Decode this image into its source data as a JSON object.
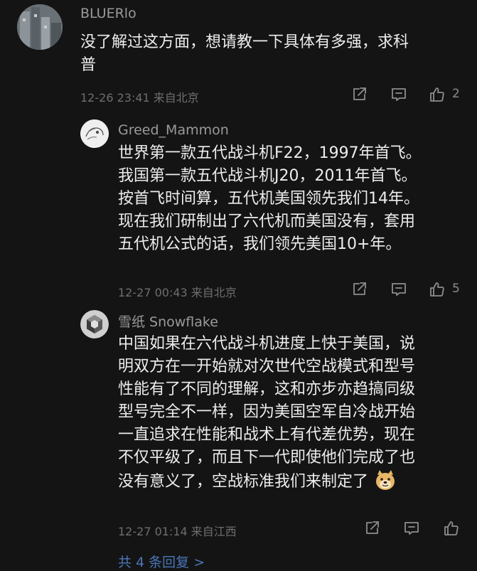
{
  "comments": [
    {
      "username": "BLUERlo",
      "lines": [
        "没了解过这方面，想请教一下具体有多强，求科",
        "普"
      ],
      "meta": "12-26 23:41 来自北京",
      "likes": "2"
    },
    {
      "username": "Greed_Mammon",
      "lines": [
        "世界第一款五代战斗机F22，1997年首飞。",
        "我国第一款五代战斗机J20，2011年首飞。",
        "按首飞时间算，五代机美国领先我们14年。",
        "现在我们研制出了六代机而美国没有，套用",
        "五代机公式的话，我们领先美国10+年。"
      ],
      "meta": "12-27 00:43 来自北京",
      "likes": "5"
    },
    {
      "username": "雪纸 Snowflake",
      "lines": [
        "中国如果在六代战斗机进度上快于美国，说",
        "明双方在一开始就对次世代空战模式和型号",
        "性能有了不同的理解，这和亦步亦趋搞同级",
        "型号完全不一样，因为美国空军自冷战开始",
        "一直追求在性能和战术上有代差优势，现在",
        "不仅平级了，而且下一代即使他们完成了也",
        "没有意义了，空战标准我们来制定了"
      ],
      "meta": "12-27 01:14 来自江西",
      "likes": ""
    }
  ],
  "more_replies": "共 4 条回复 >",
  "icons": {
    "share": "share-icon",
    "reply": "comment-icon",
    "like": "thumbs-up-icon",
    "emoji": "doge-emoji-icon"
  },
  "colors": {
    "background": "#141414",
    "link": "#4a76b8"
  }
}
